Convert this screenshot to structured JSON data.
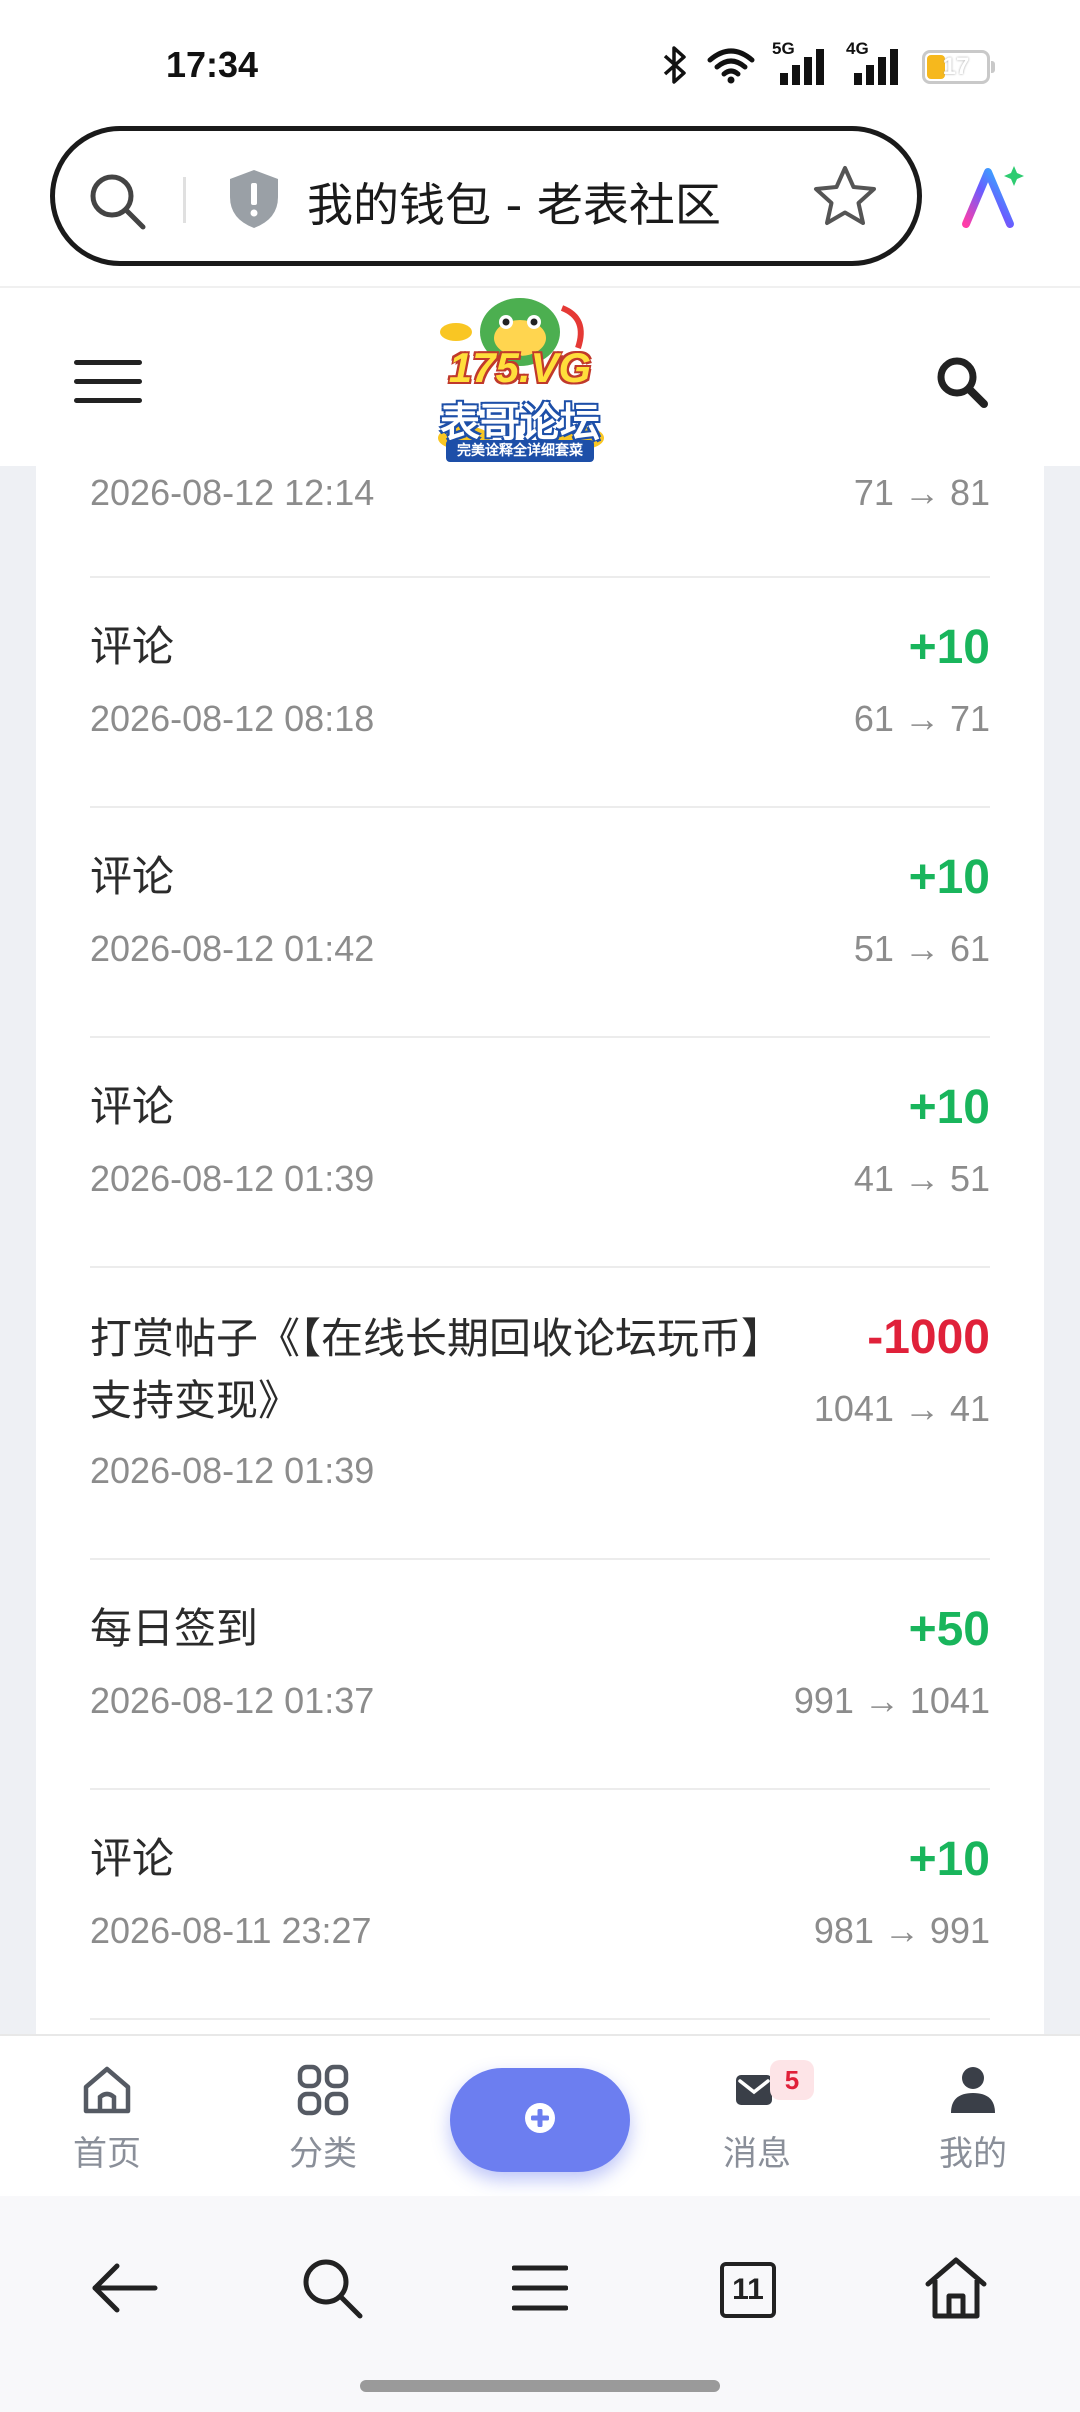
{
  "status_bar": {
    "time": "17:34",
    "network_5g": "5G",
    "network_4g": "4G",
    "battery_level": "17",
    "icons": [
      "bluetooth-icon",
      "wifi-icon",
      "signal-5g-icon",
      "signal-4g-icon",
      "battery-icon"
    ]
  },
  "browser": {
    "page_title": "我的钱包 - 老表社区",
    "tab_count": "11"
  },
  "site": {
    "logo_main": "175.VG",
    "logo_sub": "表哥论坛",
    "logo_banner": "完美诠释全详细套菜"
  },
  "transactions": [
    {
      "title": "",
      "date": "2026-08-12 12:14",
      "amount": "",
      "balance": "71 → 81"
    },
    {
      "title": "评论",
      "date": "2026-08-12 08:18",
      "amount": "+10",
      "balance": "61 → 71"
    },
    {
      "title": "评论",
      "date": "2026-08-12 01:42",
      "amount": "+10",
      "balance": "51 → 61"
    },
    {
      "title": "评论",
      "date": "2026-08-12 01:39",
      "amount": "+10",
      "balance": "41 → 51"
    },
    {
      "title": "打赏帖子《【在线长期回收论坛玩币】支持变现》",
      "date": "2026-08-12 01:39",
      "amount": "-1000",
      "balance": "1041 → 41"
    },
    {
      "title": "每日签到",
      "date": "2026-08-12 01:37",
      "amount": "+50",
      "balance": "991 → 1041"
    },
    {
      "title": "评论",
      "date": "2026-08-11 23:27",
      "amount": "+10",
      "balance": "981 → 991"
    }
  ],
  "bottom_nav": {
    "home": "首页",
    "categories": "分类",
    "messages": "消息",
    "messages_badge": "5",
    "mine": "我的"
  },
  "colors": {
    "positive": "#19b55c",
    "negative": "#e0213a",
    "accent": "#6c7ef0"
  }
}
